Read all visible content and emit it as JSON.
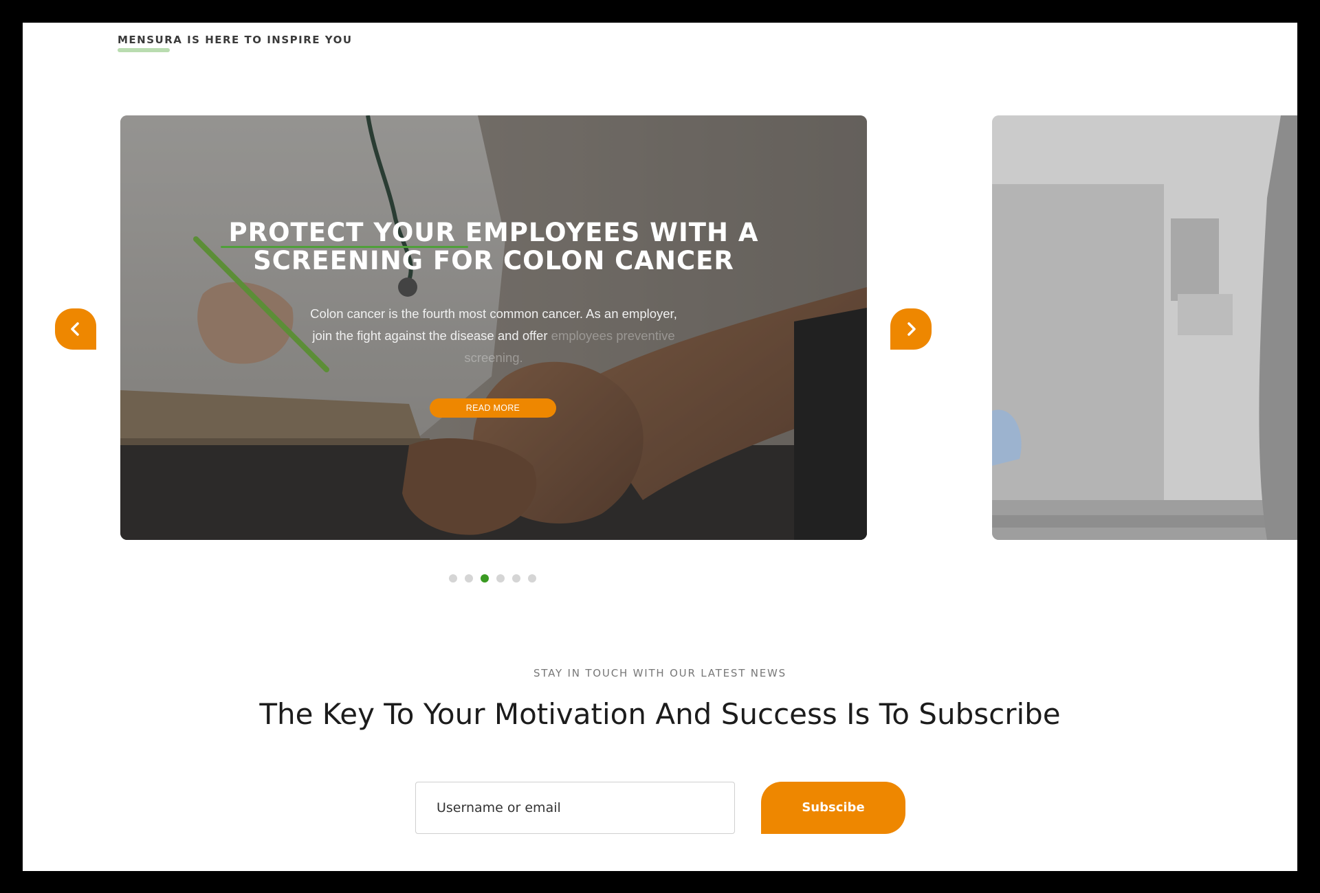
{
  "header": {
    "eyebrow": "MENSURA IS HERE TO INSPIRE YOU"
  },
  "carousel": {
    "active_slide": {
      "title": "PROTECT YOUR EMPLOYEES WITH A SCREENING FOR COLON CANCER",
      "description": "Colon cancer is the fourth most common cancer. As an employer, join the fight against the disease and offer",
      "description_faded": "employees preventive screening.",
      "button_label": "READ MORE"
    },
    "prev_icon": "chevron-left-icon",
    "next_icon": "chevron-right-icon",
    "dot_count": 6,
    "active_dot_index": 3
  },
  "subscribe": {
    "eyebrow": "STAY IN TOUCH WITH OUR LATEST NEWS",
    "title": "The Key To Your Motivation And Success Is To Subscribe",
    "input_placeholder": "Username or email",
    "button_label": "Subscibe"
  },
  "colors": {
    "accent_orange": "#ee8700",
    "accent_green": "#3a9a22",
    "underline_green": "#b9dcb0"
  }
}
